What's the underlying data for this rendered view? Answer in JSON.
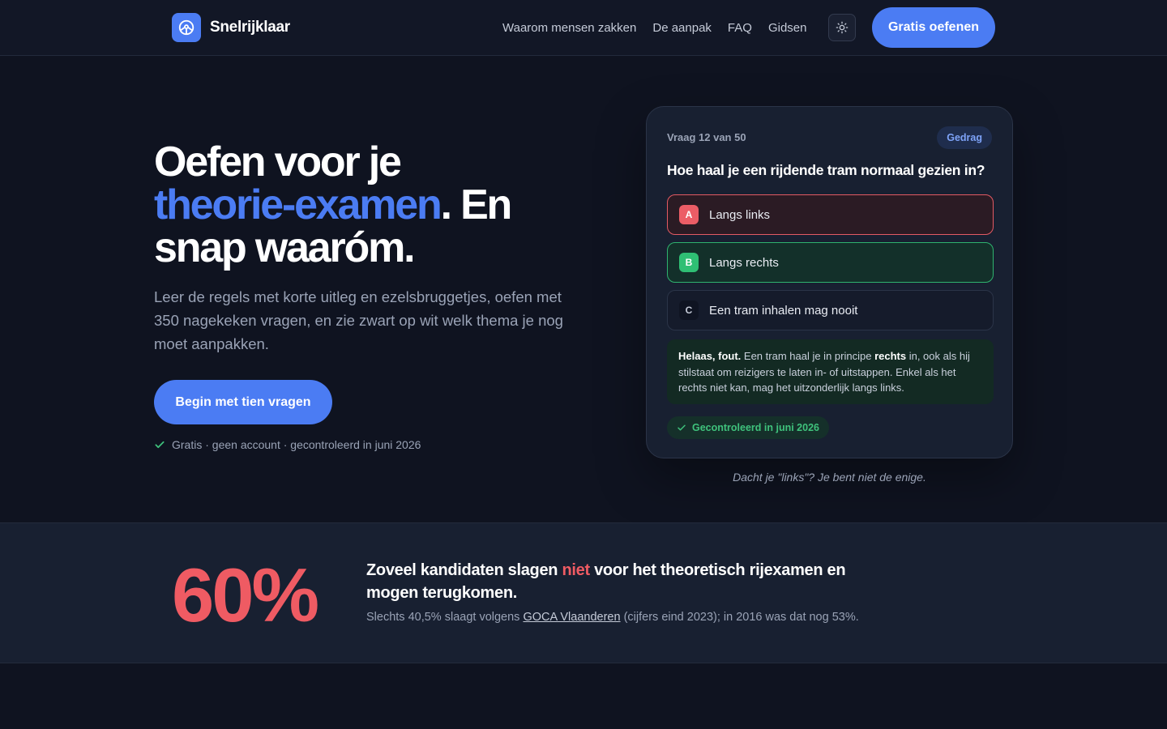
{
  "brand": {
    "name": "Snelrijklaar",
    "logo_icon": "steering-wheel-icon"
  },
  "nav": {
    "links": [
      "Waarom mensen zakken",
      "De aanpak",
      "FAQ",
      "Gidsen"
    ],
    "theme_icon": "sun-icon",
    "cta": "Gratis oefenen"
  },
  "hero": {
    "title_1": "Oefen voor je",
    "title_accent": "theorie-examen",
    "title_2": ". En",
    "title_3": "snap waaróm.",
    "subtitle": "Leer de regels met korte uitleg en ezelsbruggetjes, oefen met 350 nagekeken vragen, en zie zwart op wit welk thema je nog moet aanpakken.",
    "cta": "Begin met tien vragen",
    "note": "Gratis · geen account · gecontroleerd in juni 2026"
  },
  "quiz": {
    "counter": "Vraag 12 van 50",
    "tag": "Gedrag",
    "question": "Hoe haal je een rijdende tram normaal gezien in?",
    "answers": [
      {
        "letter": "A",
        "text": "Langs links",
        "state": "wrong"
      },
      {
        "letter": "B",
        "text": "Langs rechts",
        "state": "correct"
      },
      {
        "letter": "C",
        "text": "Een tram inhalen mag nooit",
        "state": "neutral"
      }
    ],
    "explain_lead": "Helaas, fout.",
    "explain_1": " Een tram haal je in principe ",
    "explain_bold": "rechts",
    "explain_2": " in, ook als hij stilstaat om reizigers te laten in- of uitstappen. Enkel als het rechts niet kan, mag het uitzonderlijk langs links.",
    "verified": "Gecontroleerd in juni 2026",
    "caption": "Dacht je \"links\"? Je bent niet de enige."
  },
  "stat": {
    "value": "60%",
    "head_1": "Zoveel kandidaten slagen ",
    "head_red": "niet",
    "head_2": " voor het theoretisch rijexamen en mogen terugkomen.",
    "sub_1": "Slechts 40,5% slaagt volgens ",
    "sub_link": "GOCA Vlaanderen",
    "sub_2": " (cijfers eind 2023); in 2016 was dat nog 53%."
  },
  "colors": {
    "accent": "#4b7cf3",
    "wrong": "#ec5d66",
    "correct": "#2fbf74",
    "background": "#0f1320"
  }
}
